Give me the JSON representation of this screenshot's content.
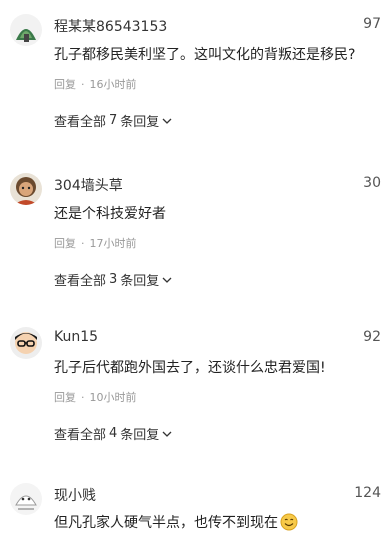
{
  "comments": [
    {
      "username": "程某某86543153",
      "likes": "97",
      "text": "孔子都移民美利坚了。这叫文化的背叛还是移民?",
      "reply_label": "回复",
      "time": "16小时前",
      "view_prefix": "查看全部",
      "reply_count": "7",
      "view_suffix": "条回复"
    },
    {
      "username": "304墙头草",
      "likes": "30",
      "text": "还是个科技爱好者",
      "reply_label": "回复",
      "time": "17小时前",
      "view_prefix": "查看全部",
      "reply_count": "3",
      "view_suffix": "条回复"
    },
    {
      "username": "Kun15",
      "likes": "92",
      "text": "孔子后代都跑外国去了，还谈什么忠君爱国!",
      "reply_label": "回复",
      "time": "10小时前",
      "view_prefix": "查看全部",
      "reply_count": "4",
      "view_suffix": "条回复"
    },
    {
      "username": "现小贱",
      "likes": "124",
      "text": "但凡孔家人硬气半点，也传不到现在",
      "emoji": "smile-emoji"
    }
  ],
  "icons": {
    "chevron": "chevron-down-icon",
    "reply_separator": "·"
  },
  "colors": {
    "secondary_text": "#999999",
    "primary_text": "#222222"
  }
}
